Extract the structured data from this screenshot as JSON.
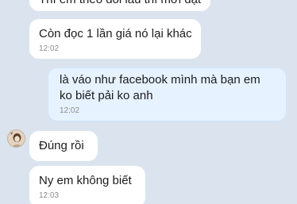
{
  "messages": [
    {
      "text": "Thì em theo dõi lâu thì mới đặt",
      "time": ""
    },
    {
      "text": "Còn đọc 1 lần giá nó lại khác",
      "time": "12:02"
    },
    {
      "text": "là váo như facebook mình mà bạn em ko biết pải ko anh",
      "time": "12:02"
    },
    {
      "text": "Đúng rồi",
      "time": ""
    },
    {
      "text": "Ny em không biết",
      "time": "12:03"
    }
  ],
  "colors": {
    "background": "#dbe4ee",
    "incoming_bubble": "#ffffff",
    "outgoing_bubble": "#e6f2ff",
    "timestamp": "#8d8d8d"
  }
}
